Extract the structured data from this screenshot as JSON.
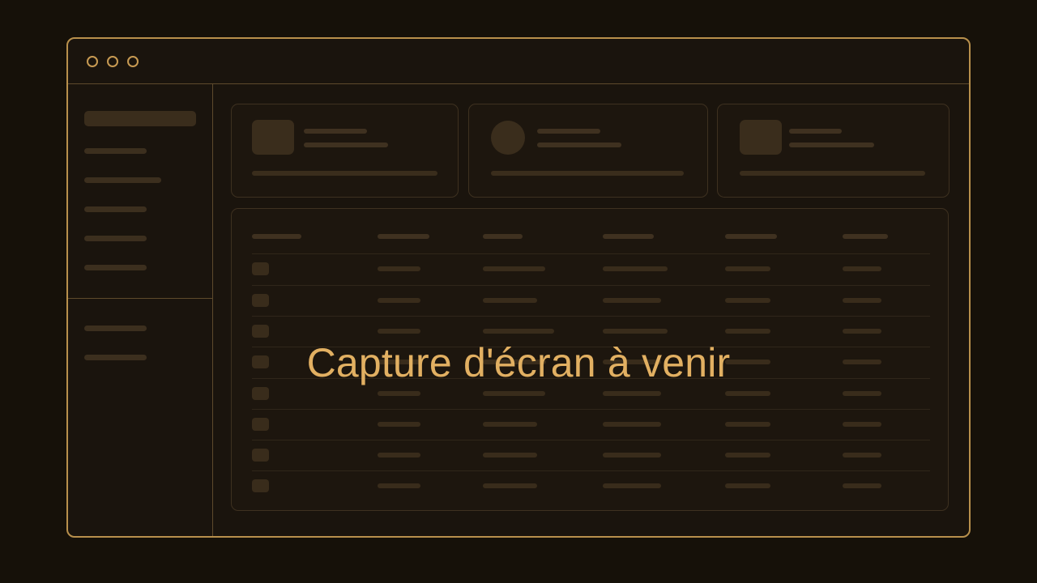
{
  "overlay": {
    "message": "Capture d'écran à venir"
  },
  "colors": {
    "background": "#161109",
    "accent": "#e2b062",
    "frame": "#b8904c"
  },
  "window_controls": [
    "circle-icon",
    "circle-icon",
    "circle-icon"
  ]
}
